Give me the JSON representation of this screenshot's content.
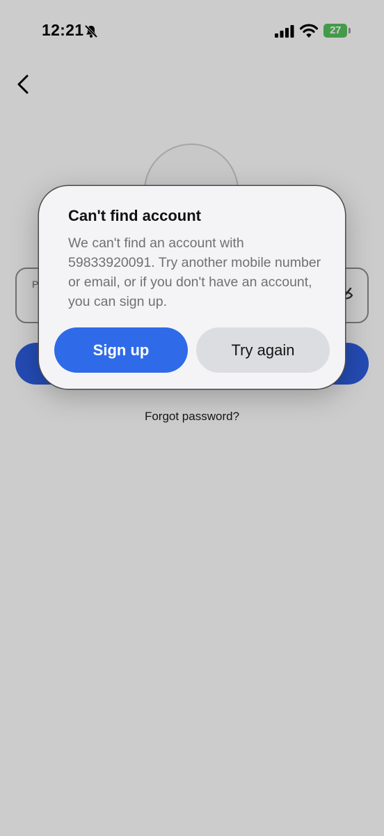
{
  "status_bar": {
    "time": "12:21",
    "battery_level": "27",
    "icons": [
      "bell-slash-icon",
      "signal-icon",
      "wifi-icon",
      "battery-icon"
    ]
  },
  "nav": {
    "back_icon": "chevron-left-icon"
  },
  "form": {
    "password_label": "P",
    "password_icon": "eye-off-icon",
    "forgot_password": "Forgot password?"
  },
  "dialog": {
    "title": "Can't find account",
    "message": "We can't find an account with 59833920091. Try another mobile number or email, or if you don't have an account, you can sign up.",
    "primary_button": "Sign up",
    "secondary_button": "Try again"
  },
  "colors": {
    "primary_blue": "#2f6be8",
    "secondary_gray": "#dcdde0",
    "battery_green": "#56c15a"
  }
}
